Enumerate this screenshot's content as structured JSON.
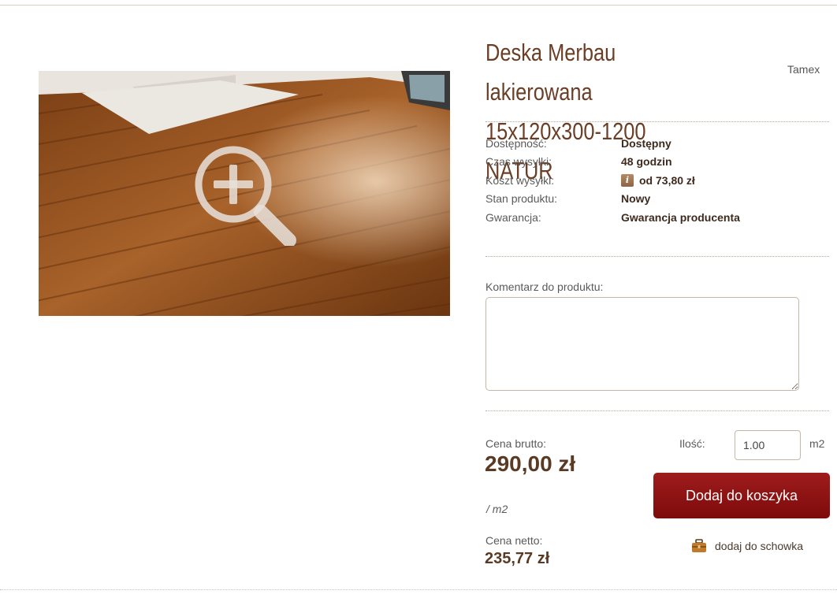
{
  "product": {
    "title_line1": "Deska Merbau lakierowana",
    "title_line2": "15x120x300-1200 NATUR",
    "brand": "Tamex"
  },
  "specs": [
    {
      "label": "Dostępność:",
      "value": "Dostępny"
    },
    {
      "label": "Czas wysyłki:",
      "value": "48 godzin"
    },
    {
      "label": "Koszt wysyłki:",
      "value": "od 73,80 zł",
      "icon": "info-icon"
    },
    {
      "label": "Stan produktu:",
      "value": "Nowy"
    },
    {
      "label": "Gwarancja:",
      "value": "Gwarancja producenta"
    }
  ],
  "info_badge": "i",
  "comment": {
    "label": "Komentarz do produktu:",
    "value": ""
  },
  "price": {
    "gross_label": "Cena brutto:",
    "gross_value": "290,00 zł",
    "unit": "/ m2",
    "net_label": "Cena netto:",
    "net_value": "235,77 zł"
  },
  "quantity": {
    "label": "Ilość:",
    "value": "1.00",
    "unit": "m2"
  },
  "actions": {
    "add_to_cart": "Dodaj do koszyka",
    "add_to_clipboard": "dodaj do schowka"
  },
  "colors": {
    "title": "#6b3e26",
    "cart_button": "#8b1212",
    "price": "#5b3a24"
  }
}
